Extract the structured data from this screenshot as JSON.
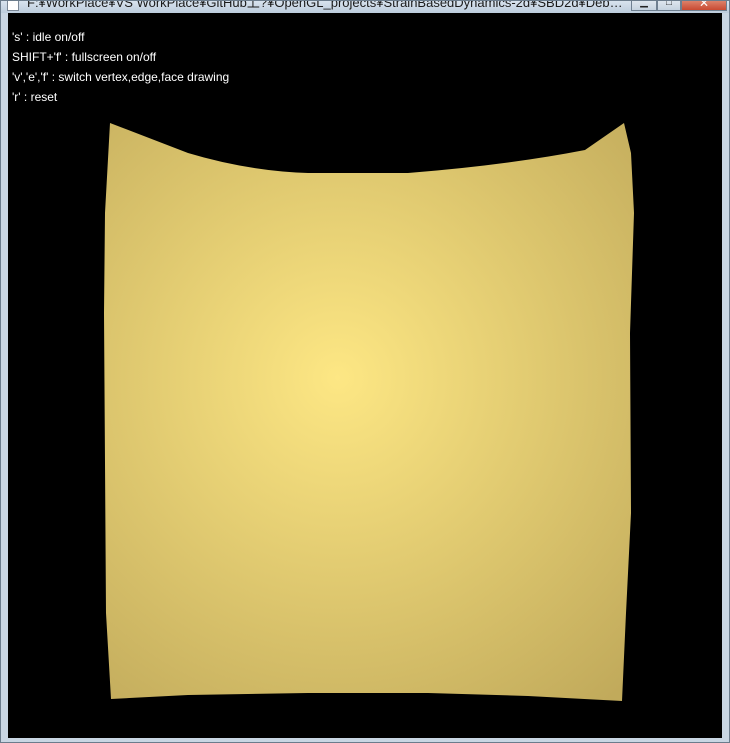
{
  "window": {
    "title": "F:¥WorkPlace¥VS WorkPlace¥GitHub上?¥OpenGL_projects¥StrainBasedDynamics-2d¥SBD2d¥Debu...",
    "minimize_glyph": "▁",
    "maximize_glyph": "□",
    "close_glyph": "✕"
  },
  "help": {
    "lines": [
      "'s' : idle on/off",
      "SHIFT+'f' : fullscreen on/off",
      "'v','e','f' : switch vertex,edge,face drawing",
      "'r' : reset"
    ]
  },
  "scene": {
    "background": "#000000",
    "cloth_center_color": "#fde784",
    "cloth_edge_color": "#c1aa5b"
  }
}
